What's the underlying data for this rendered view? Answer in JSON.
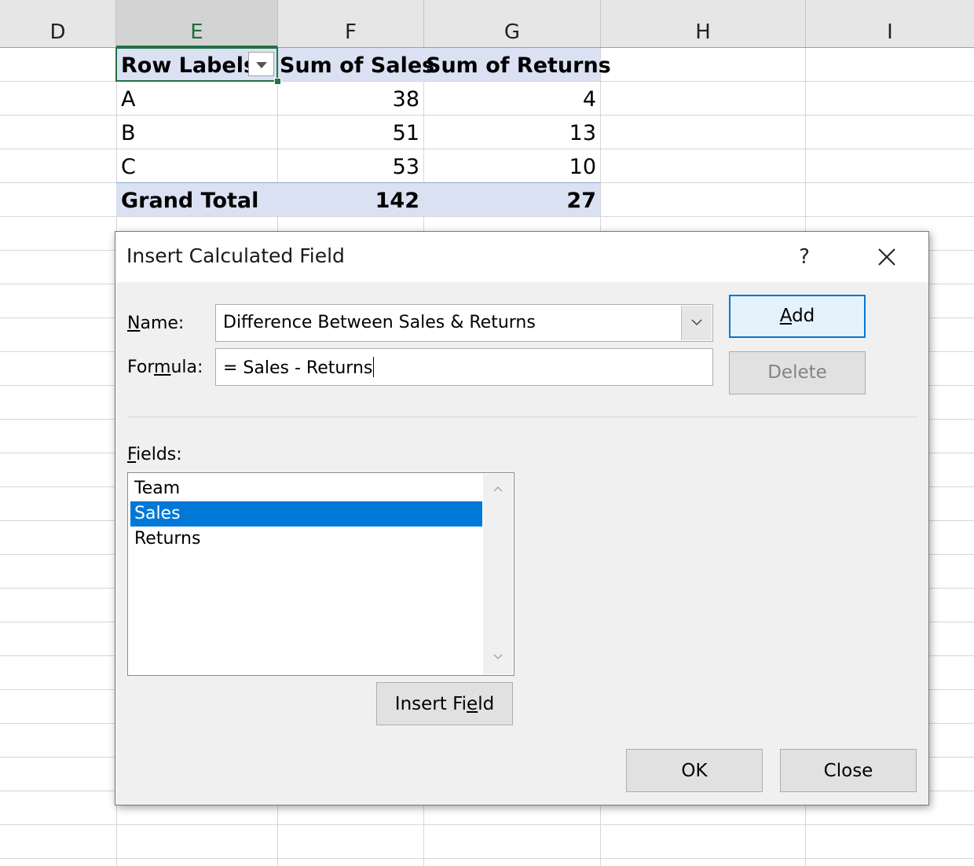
{
  "spreadsheet": {
    "columns": [
      "D",
      "E",
      "F",
      "G",
      "H",
      "I"
    ],
    "selected_column": "E",
    "pivot": {
      "headers": [
        "Row Labels",
        "Sum of Sales",
        "Sum of Returns"
      ],
      "rows": [
        [
          "A",
          "38",
          "4"
        ],
        [
          "B",
          "51",
          "13"
        ],
        [
          "C",
          "53",
          "10"
        ]
      ],
      "grand_total": [
        "Grand Total",
        "142",
        "27"
      ]
    }
  },
  "dialog": {
    "title": "Insert Calculated Field",
    "help_label": "?",
    "name_label_prefix": "",
    "name_label_key": "N",
    "name_label_rest": "ame:",
    "name_value": "Difference Between Sales & Returns",
    "formula_label_prefix": "For",
    "formula_label_key": "m",
    "formula_label_rest": "ula:",
    "formula_value": "= Sales - Returns",
    "add_key": "A",
    "add_rest": "dd",
    "delete_label": "Delete",
    "fields_label_key": "F",
    "fields_label_rest": "ields:",
    "fields": [
      "Team",
      "Sales",
      "Returns"
    ],
    "selected_field": "Sales",
    "insert_field_prefix": "Insert Fi",
    "insert_field_key": "e",
    "insert_field_rest": "ld",
    "ok_label": "OK",
    "close_label": "Close"
  },
  "colors": {
    "accent": "#0078d7",
    "pivot_band": "#d9e1f2",
    "active_cell": "#217346"
  }
}
